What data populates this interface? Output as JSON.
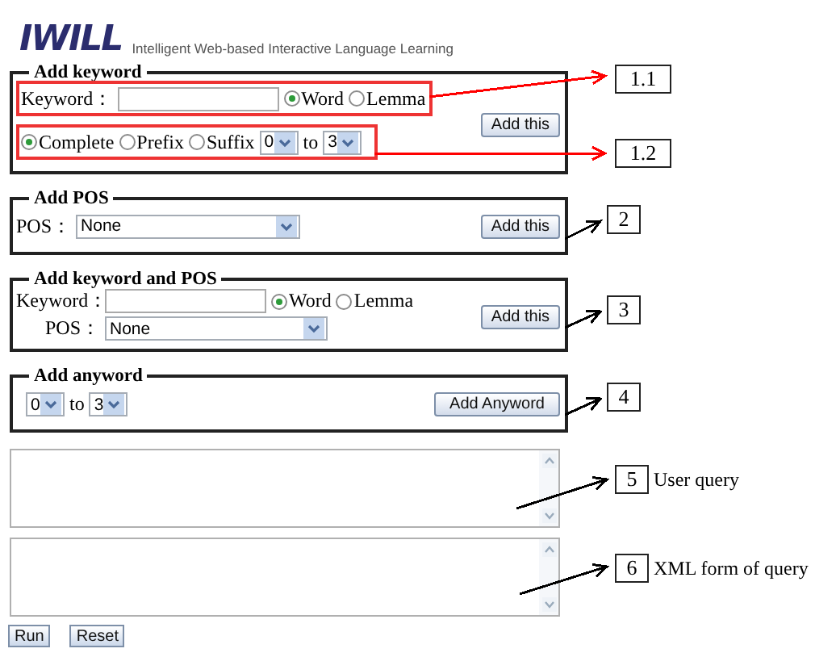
{
  "header": {
    "logo": "IWILL",
    "tagline": "Intelligent Web-based Interactive Language Learning"
  },
  "sections": [
    {
      "kind": "keyword",
      "title": "Add keyword",
      "keyword_label": "Keyword：",
      "radios": [
        {
          "label": "Word",
          "selected": true
        },
        {
          "label": "Lemma",
          "selected": false
        }
      ],
      "match": [
        {
          "label": "Complete",
          "selected": true
        },
        {
          "label": "Prefix",
          "selected": false
        },
        {
          "label": "Suffix",
          "selected": false
        }
      ],
      "from": "0",
      "to_label": "to",
      "to": "3",
      "button": "Add this"
    },
    {
      "kind": "pos",
      "title": "Add POS",
      "pos_label": "POS：",
      "pos_value": "None",
      "button": "Add this"
    },
    {
      "kind": "keyword_pos",
      "title": "Add keyword and POS",
      "keyword_label": "Keyword：",
      "radios": [
        {
          "label": "Word",
          "selected": true
        },
        {
          "label": "Lemma",
          "selected": false
        }
      ],
      "pos_label": "POS：",
      "pos_value": "None",
      "button": "Add this"
    },
    {
      "kind": "anyword",
      "title": "Add anyword",
      "from": "0",
      "to_label": "to",
      "to": "3",
      "button": "Add Anyword"
    }
  ],
  "outputs": [
    {
      "kind": "textarea"
    },
    {
      "kind": "textarea"
    }
  ],
  "buttons": [
    "Run",
    "Reset"
  ],
  "callouts": [
    {
      "label": "1.1",
      "color": "#ff0000"
    },
    {
      "label": "1.2",
      "color": "#ff0000"
    },
    {
      "label": "2",
      "color": "#000000"
    },
    {
      "label": "3",
      "color": "#000000"
    },
    {
      "label": "4",
      "color": "#000000"
    },
    {
      "label": "5",
      "color": "#000000",
      "caption": "User query"
    },
    {
      "label": "6",
      "color": "#000000",
      "caption": "XML form of query"
    }
  ]
}
